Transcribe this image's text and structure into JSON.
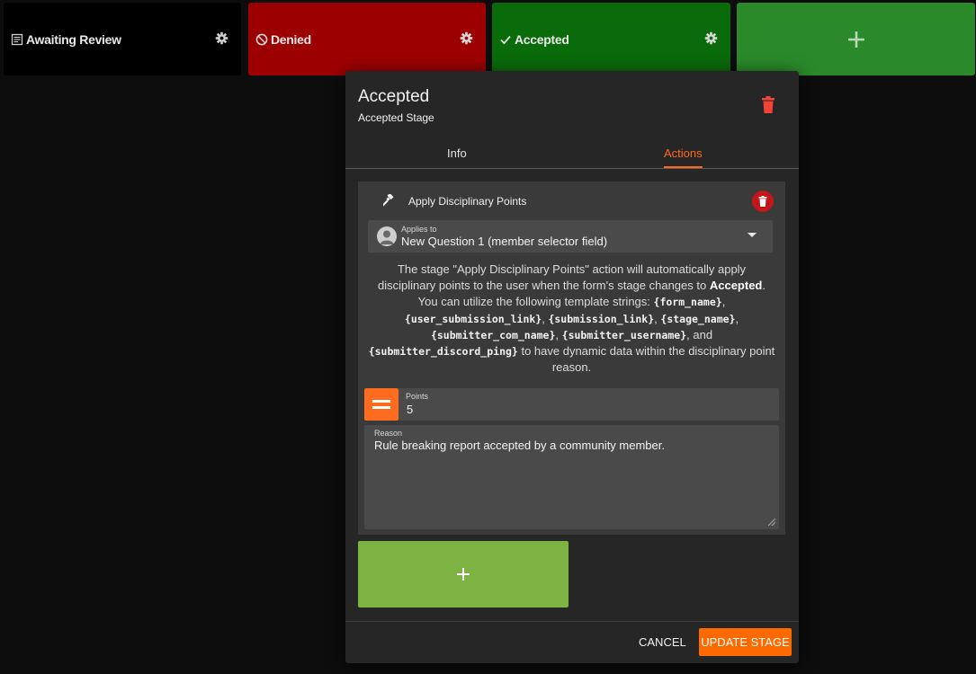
{
  "stages": {
    "awaiting": {
      "label": "Awaiting Review",
      "icon": "form-icon"
    },
    "denied": {
      "label": "Denied",
      "icon": "block-icon"
    },
    "accepted": {
      "label": "Accepted",
      "icon": "check-icon"
    },
    "add": {
      "icon": "plus-icon"
    }
  },
  "modal": {
    "title": "Accepted",
    "subtitle": "Accepted Stage",
    "tabs": [
      {
        "label": "Info",
        "active": false
      },
      {
        "label": "Actions",
        "active": true
      }
    ],
    "action": {
      "label": "Apply Disciplinary Points",
      "icon": "gavel-icon",
      "applies_to": {
        "label": "Applies to",
        "value": "New Question 1 (member selector field)"
      },
      "description": {
        "p1": "The stage \"Apply Disciplinary Points\" action will automatically apply disciplinary points to the user when the form's stage changes to ",
        "stage": "Accepted",
        "p2": ". You can utilize the following template strings: ",
        "t1": "{form_name}",
        "t2": "{user_submission_link}",
        "t3": "{submission_link}",
        "t4": "{stage_name}",
        "t5": "{submitter_com_name}",
        "t6": "{submitter_username}",
        "t7": "{submitter_discord_ping}",
        "p3": " to have dynamic data within the disciplinary point reason."
      },
      "points": {
        "label": "Points",
        "value": "5"
      },
      "reason": {
        "label": "Reason",
        "value": "Rule breaking report accepted by a community member."
      }
    },
    "cancel_label": "CANCEL",
    "update_label": "UPDATE STAGE"
  },
  "colors": {
    "accent": "#ff6a00",
    "denied": "#9d0000",
    "accepted": "#0a6b0a",
    "add_stage": "#2a8a2a",
    "add_action": "#7cb342",
    "delete": "#c0171a"
  }
}
